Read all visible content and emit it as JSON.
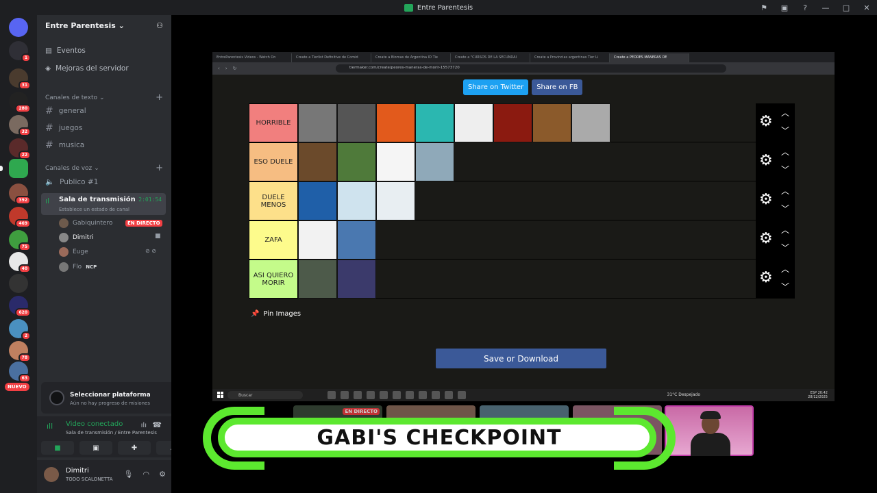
{
  "window": {
    "title": "Entre Parentesis"
  },
  "rail": {
    "badges": [
      "1",
      "31",
      "280",
      "32",
      "22",
      "392",
      "469",
      "75",
      "40",
      "620",
      "2",
      "78",
      "63"
    ],
    "new_label": "NUEVO"
  },
  "server": {
    "name": "Entre Parentesis",
    "nav": [
      {
        "label": "Eventos"
      },
      {
        "label": "Mejoras del servidor"
      }
    ],
    "text_category": "Canales de texto",
    "text_channels": [
      "general",
      "juegos",
      "musica"
    ],
    "voice_category": "Canales de voz",
    "voice_channels": [
      "Publico #1"
    ],
    "stage": {
      "name": "Sala de transmisión",
      "status": "Establece un estado de canal",
      "time": "2:01:54"
    },
    "users": [
      {
        "name": "Gabiquintero",
        "live": "EN DIRECTO"
      },
      {
        "name": "Dimitri"
      },
      {
        "name": "Euge"
      },
      {
        "name": "Flo",
        "tag": "NCP"
      }
    ]
  },
  "platform": {
    "title": "Seleccionar plataforma",
    "subtitle": "Aún no hay progreso de misiones"
  },
  "voice": {
    "status": "Video conectado",
    "location": "Sala de transmisión / Entre Parentesis"
  },
  "user": {
    "name": "Dimitri",
    "status": "TODO SCALONETTA"
  },
  "browser": {
    "tabs": [
      "EntreParentesis Videos - Watch On",
      "Create a Tierlist Definitive de Comid",
      "Create a Biomas de Argentina ID Tie",
      "Create a \"CURSOS DE LA SECUNDAI",
      "Create a Provincias argentinas Tier Li",
      "Create a PEORES MANERAS DE"
    ],
    "url": "tiermaker.com/create/peores-maneras-de-morir-15573720"
  },
  "share": {
    "twitter": "Share on Twitter",
    "fb": "Share on FB"
  },
  "tiers": [
    {
      "label": "HORRIBLE",
      "color": "#f17f7e",
      "count": 8,
      "colors": [
        "#777",
        "#555",
        "#e25a1c",
        "#2bb7b0",
        "#eee",
        "#8b1a10",
        "#8b5a2b",
        "#aaa"
      ]
    },
    {
      "label": "ESO DUELE",
      "color": "#f6bd82",
      "count": 4,
      "colors": [
        "#6b4a2b",
        "#4f7a3a",
        "#f5f5f5",
        "#8fa9b9"
      ]
    },
    {
      "label": "DUELE MENOS",
      "color": "#fde08a",
      "count": 3,
      "colors": [
        "#1f5fa8",
        "#cfe3ee",
        "#e8eef2"
      ]
    },
    {
      "label": "ZAFA",
      "color": "#fdfb8c",
      "count": 2,
      "colors": [
        "#f2f2f2",
        "#4a78b0"
      ]
    },
    {
      "label": "ASI QUIERO MORIR",
      "color": "#c4fb8a",
      "count": 2,
      "colors": [
        "#4d5a4a",
        "#3b3a6b"
      ]
    }
  ],
  "pin": "Pin Images",
  "save": "Save or Download",
  "taskbar": {
    "search": "Buscar",
    "weather": "31°C Despejado",
    "lang": "ESP",
    "time": "20:42",
    "date": "28/12/2025"
  },
  "stream_live": "EN DIRECTO",
  "banner": "GABI'S CHECKPOINT"
}
